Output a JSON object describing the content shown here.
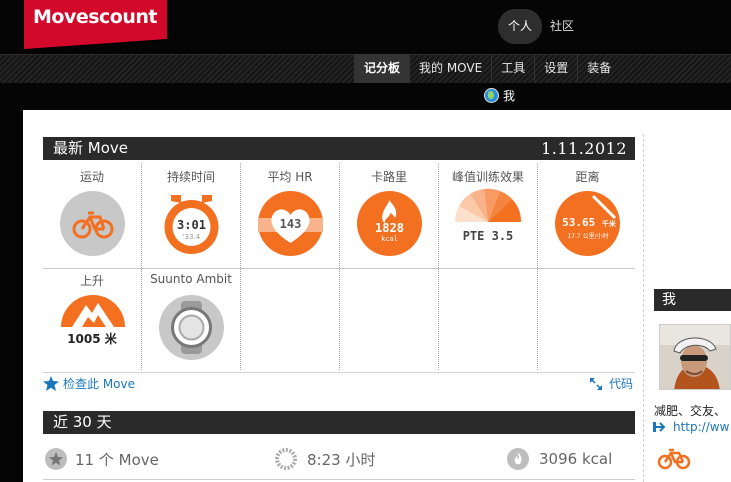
{
  "brand": {
    "logo_text": "Movescount",
    "color": "#d3092c"
  },
  "top_nav": {
    "personal": "个人",
    "community": "社区"
  },
  "main_nav": {
    "dashboard": "记分板",
    "my_move": "我的 MOVE",
    "tools": "工具",
    "settings": "设置",
    "gear": "装备"
  },
  "me_link": {
    "label": "我"
  },
  "latest_move": {
    "title": "最新 Move",
    "date": "1.11.2012",
    "stats": {
      "activity": {
        "label": "运动",
        "icon": "bicycle-icon"
      },
      "duration": {
        "label": "持续时间",
        "value": "3:01",
        "sub": "'33.4"
      },
      "avg_hr": {
        "label": "平均 HR",
        "value": "143"
      },
      "calories": {
        "label": "卡路里",
        "value": "1828",
        "unit": "kcal"
      },
      "pte": {
        "label": "峰值训练效果",
        "value": "PTE 3.5"
      },
      "distance": {
        "label": "距离",
        "value": "53.65",
        "unit": "千米",
        "sub": "17.7 公里/小时"
      },
      "ascent": {
        "label": "上升",
        "value": "1005 米"
      },
      "device": {
        "label": "Suunto Ambit",
        "icon": "watch-icon"
      }
    },
    "view_link": "检查此 Move",
    "code_link": "代码"
  },
  "last_30_days": {
    "title": "近 30 天",
    "moves": "11 个 Move",
    "duration": "8:23 小时",
    "calories": "3096 kcal"
  },
  "sidebar": {
    "title": "我",
    "bio": "减肥、交友、",
    "url": "http://ww"
  },
  "colors": {
    "accent": "#f37021",
    "link": "#1b75bb",
    "bar": "#2a2a2a"
  }
}
